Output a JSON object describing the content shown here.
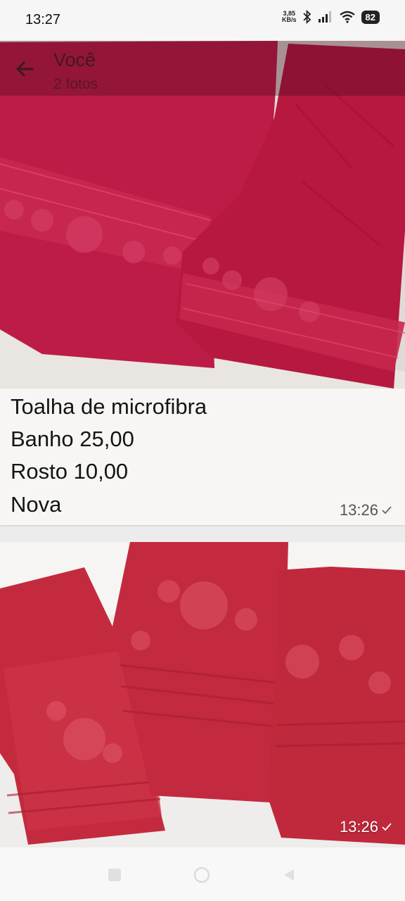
{
  "status_bar": {
    "time": "13:27",
    "net_speed_value": "3,85",
    "net_speed_unit": "KB/s",
    "battery": "82"
  },
  "header": {
    "title": "Você",
    "subtitle": "2 fotos"
  },
  "message": {
    "lines": [
      "Toalha de microfibra",
      "Banho 25,00",
      "Rosto 10,00",
      "Nova"
    ],
    "time": "13:26"
  },
  "second_photo": {
    "time": "13:26"
  },
  "colors": {
    "towel_dark": "#b81d45",
    "towel_mid": "#d02c55",
    "towel_red": "#c42a3e",
    "background": "#ececec"
  },
  "icons": {
    "back": "arrow-left-icon",
    "read_status": "check-icon",
    "nav_recents": "square-icon",
    "nav_home": "circle-icon",
    "nav_back": "triangle-icon"
  }
}
